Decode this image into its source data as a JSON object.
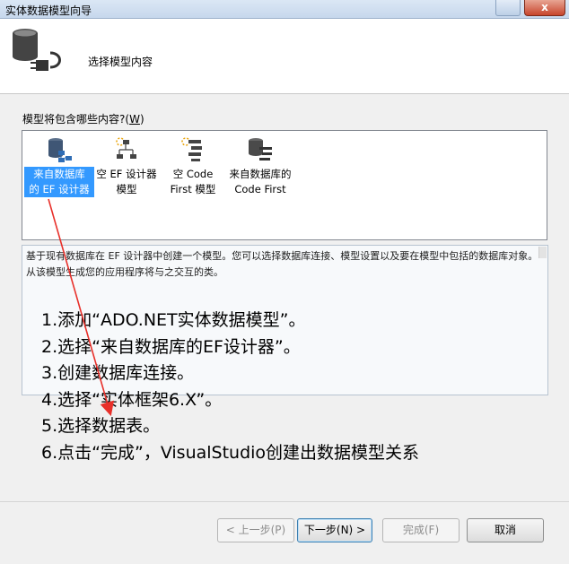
{
  "window": {
    "title": "实体数据模型向导",
    "close_label": "x"
  },
  "header": {
    "title": "选择模型内容"
  },
  "question": {
    "text": "模型将包含哪些内容?(",
    "accel": "W",
    "suffix": ")"
  },
  "model_options": [
    {
      "line1": "来自数据库",
      "line2": "的 EF 设计器",
      "selected": true,
      "icon": "database-model-icon"
    },
    {
      "line1": "空 EF 设计器",
      "line2": "模型",
      "selected": false,
      "icon": "empty-designer-icon"
    },
    {
      "line1": "空 Code",
      "line2": "First 模型",
      "selected": false,
      "icon": "empty-code-first-icon"
    },
    {
      "line1": "来自数据库的",
      "line2": "Code First",
      "selected": false,
      "icon": "database-code-first-icon"
    }
  ],
  "description": "基于现有数据库在 EF 设计器中创建一个模型。您可以选择数据库连接、模型设置以及要在模型中包括的数据库对象。从该模型生成您的应用程序将与之交互的类。",
  "instructions": [
    "1.添加“ADO.NET实体数据模型”。",
    "2.选择“来自数据库的EF设计器”。",
    "3.创建数据库连接。",
    "4.选择“实体框架6.X”。",
    "5.选择数据表。",
    "6.点击“完成”，VisualStudio创建出数据模型关系"
  ],
  "buttons": {
    "back": "< 上一步(P)",
    "next": "下一步(N) >",
    "finish": "完成(F)",
    "cancel": "取消"
  },
  "colors": {
    "selection": "#3399ff",
    "arrow": "#e8302a"
  }
}
